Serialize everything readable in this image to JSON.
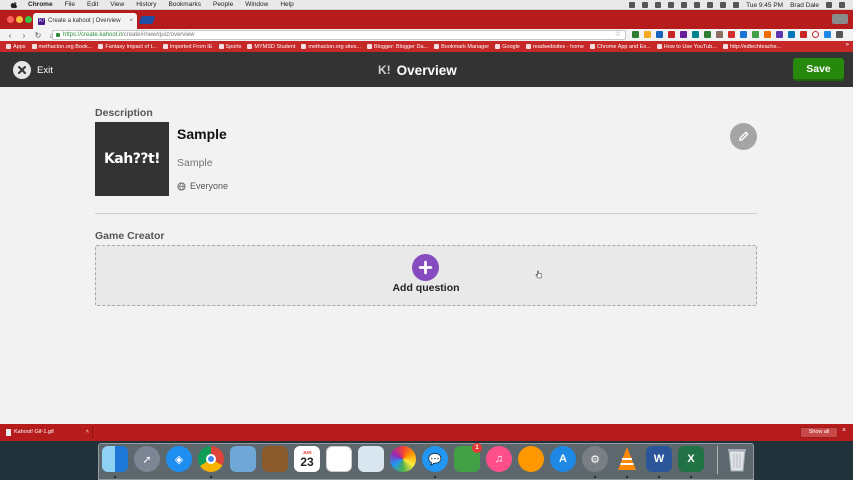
{
  "mac_menubar": {
    "app": "Chrome",
    "items": [
      "File",
      "Edit",
      "View",
      "History",
      "Bookmarks",
      "People",
      "Window",
      "Help"
    ],
    "clock": "Tue 9:45 PM",
    "user": "Brad Dale"
  },
  "browser": {
    "tab_title": "Create a kahoot | Overview",
    "tab_favicon": "K!",
    "profile_label": "",
    "url_host": "https://create.kahoot.it",
    "url_path": "/create#/new/quiz/overview",
    "bookmarks": [
      "Apps",
      "methacton.org Book...",
      "Fantasy Impact of t...",
      "Imported From IE",
      "Sports",
      "MYMSD Student",
      "methacton.org sites...",
      "Blogger: Blogger Da...",
      "Bookmark Manager",
      "Google",
      "readwebsites - home",
      "Chrome App and Ex...",
      "How to Use YouTub...",
      "http://edtechteache..."
    ],
    "bookmarks_more": "»"
  },
  "header": {
    "exit_label": "Exit",
    "logo_text": "K!",
    "title": "Overview",
    "save_label": "Save"
  },
  "description": {
    "section_title": "Description",
    "cover_text": "Kah??t!",
    "quiz_title": "Sample",
    "quiz_description": "Sample",
    "visibility": "Everyone"
  },
  "game_creator": {
    "section_title": "Game Creator",
    "add_question_label": "Add question"
  },
  "downloads": {
    "file_name": "Kahoot! Gif-1.gif",
    "show_all_label": "Show all"
  },
  "dock": {
    "calendar_month": "JUN",
    "calendar_day": "23",
    "facetime_badge": "1"
  },
  "colors": {
    "chrome_red": "#b71c1c",
    "header_bg": "#333333",
    "save_green": "#26890c",
    "add_purple": "#864cbf"
  }
}
